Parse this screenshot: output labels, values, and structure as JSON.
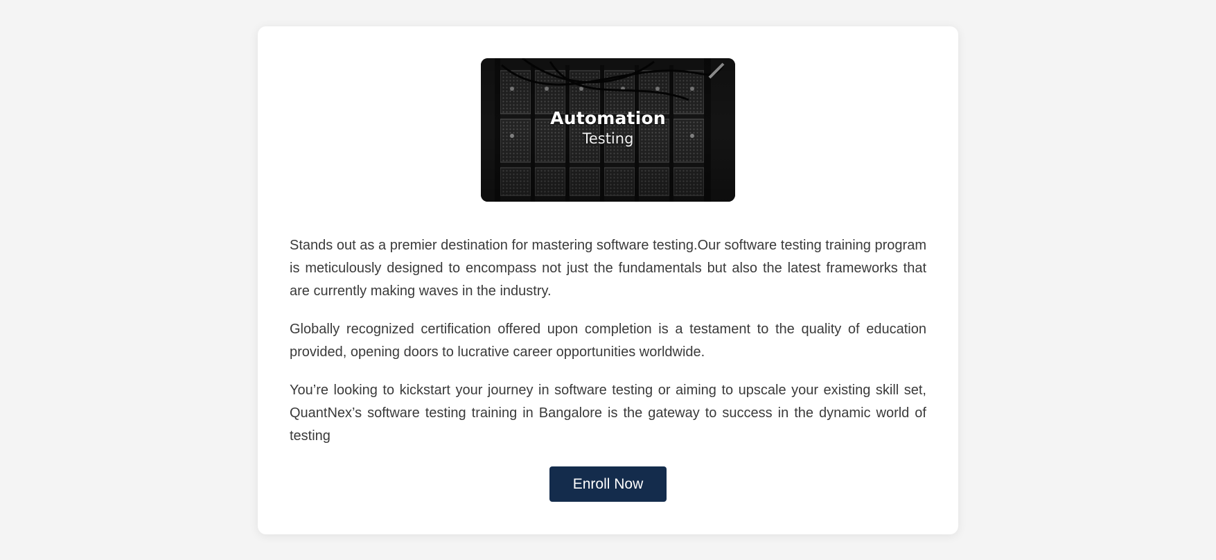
{
  "banner": {
    "title": "Automation",
    "subtitle": "Testing",
    "image_icon": "server-rack-image"
  },
  "paragraphs": [
    "Stands out as a premier destination for mastering software testing.Our software testing training program is meticulously designed to encompass not just the fundamentals but also the latest frameworks that are currently making waves in the industry.",
    "Globally recognized certification offered upon completion is a testament to the quality of education provided, opening doors to lucrative career opportunities worldwide.",
    "You’re looking to kickstart your journey in software testing or aiming to upscale your existing skill set, QuantNex’s software testing training in Bangalore is the gateway to success in the dynamic world of testing"
  ],
  "enroll_button": {
    "label": "Enroll Now"
  },
  "colors": {
    "page_background": "#f4f4f4",
    "card_background": "#ffffff",
    "button_background": "#142c4c",
    "body_text": "#3a3a3a"
  }
}
